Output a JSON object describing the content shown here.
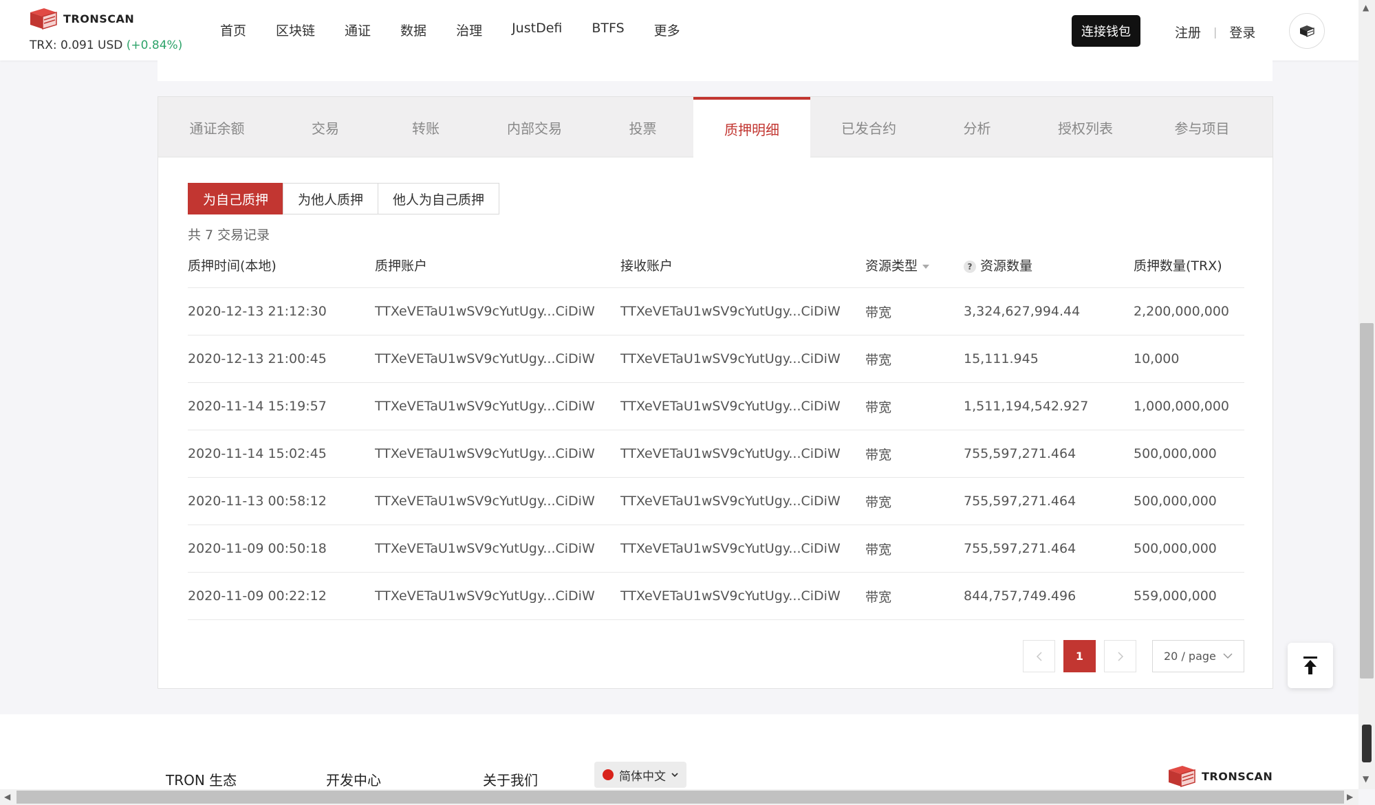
{
  "header": {
    "brand": "TRONSCAN",
    "price_label": "TRX: 0.091 USD",
    "price_change": "(+0.84%)",
    "nav": [
      "首页",
      "区块链",
      "通证",
      "数据",
      "治理",
      "JustDefi",
      "BTFS",
      "更多"
    ],
    "connect_wallet": "连接钱包",
    "register": "注册",
    "login": "登录"
  },
  "tabs": [
    "通证余额",
    "交易",
    "转账",
    "内部交易",
    "投票",
    "质押明细",
    "已发合约",
    "分析",
    "授权列表",
    "参与项目"
  ],
  "active_tab": "质押明细",
  "sub_tabs": [
    "为自己质押",
    "为他人质押",
    "他人为自己质押"
  ],
  "record_count": "共 7 交易记录",
  "table": {
    "headers": [
      "质押时间(本地)",
      "质押账户",
      "接收账户",
      "资源类型",
      "资源数量",
      "质押数量(TRX)"
    ],
    "rows": [
      [
        "2020-12-13 21:12:30",
        "TTXeVETaU1wSV9cYutUgy...CiDiW",
        "TTXeVETaU1wSV9cYutUgy...CiDiW",
        "带宽",
        "3,324,627,994.44",
        "2,200,000,000"
      ],
      [
        "2020-12-13 21:00:45",
        "TTXeVETaU1wSV9cYutUgy...CiDiW",
        "TTXeVETaU1wSV9cYutUgy...CiDiW",
        "带宽",
        "15,111.945",
        "10,000"
      ],
      [
        "2020-11-14 15:19:57",
        "TTXeVETaU1wSV9cYutUgy...CiDiW",
        "TTXeVETaU1wSV9cYutUgy...CiDiW",
        "带宽",
        "1,511,194,542.927",
        "1,000,000,000"
      ],
      [
        "2020-11-14 15:02:45",
        "TTXeVETaU1wSV9cYutUgy...CiDiW",
        "TTXeVETaU1wSV9cYutUgy...CiDiW",
        "带宽",
        "755,597,271.464",
        "500,000,000"
      ],
      [
        "2020-11-13 00:58:12",
        "TTXeVETaU1wSV9cYutUgy...CiDiW",
        "TTXeVETaU1wSV9cYutUgy...CiDiW",
        "带宽",
        "755,597,271.464",
        "500,000,000"
      ],
      [
        "2020-11-09 00:50:18",
        "TTXeVETaU1wSV9cYutUgy...CiDiW",
        "TTXeVETaU1wSV9cYutUgy...CiDiW",
        "带宽",
        "755,597,271.464",
        "500,000,000"
      ],
      [
        "2020-11-09 00:22:12",
        "TTXeVETaU1wSV9cYutUgy...CiDiW",
        "TTXeVETaU1wSV9cYutUgy...CiDiW",
        "带宽",
        "844,757,749.496",
        "559,000,000"
      ]
    ]
  },
  "pagination": {
    "current_page": "1",
    "page_size": "20 / page"
  },
  "footer": {
    "links": [
      "TRON 生态",
      "开发中心",
      "关于我们"
    ],
    "language": "简体中文",
    "brand": "TRONSCAN"
  },
  "colors": {
    "accent": "#c23631",
    "positive": "#2ea36a",
    "connect_button": "#111111"
  }
}
